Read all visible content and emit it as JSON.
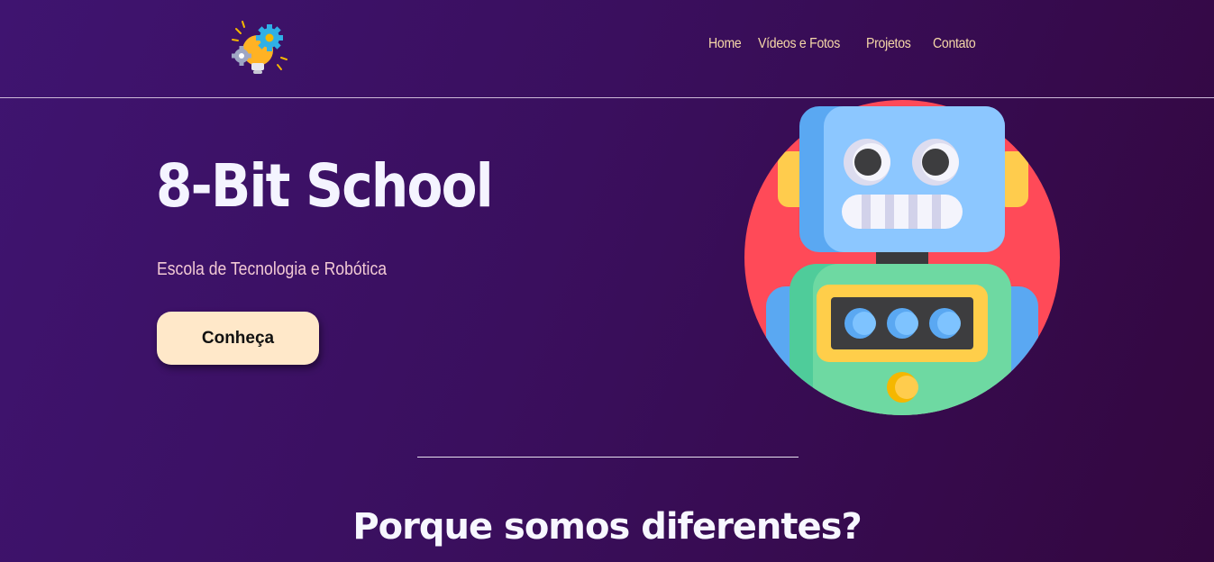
{
  "nav": {
    "items": [
      {
        "label": "Home"
      },
      {
        "label": "Vídeos e Fotos"
      },
      {
        "label": "Projetos"
      },
      {
        "label": "Contato"
      }
    ]
  },
  "hero": {
    "title": "8-Bit School",
    "subtitle": "Escola de Tecnologia e Robótica",
    "button_label": "Conheça"
  },
  "section": {
    "title": "Porque somos diferentes?"
  },
  "icons": {
    "logo": "lightbulb-gears-icon",
    "hero_image": "robot-icon"
  },
  "colors": {
    "background": "#3a0f5e",
    "nav_text": "#f6d8a8",
    "button_bg": "#ffe8c9",
    "subtitle": "#f2c9d4"
  }
}
